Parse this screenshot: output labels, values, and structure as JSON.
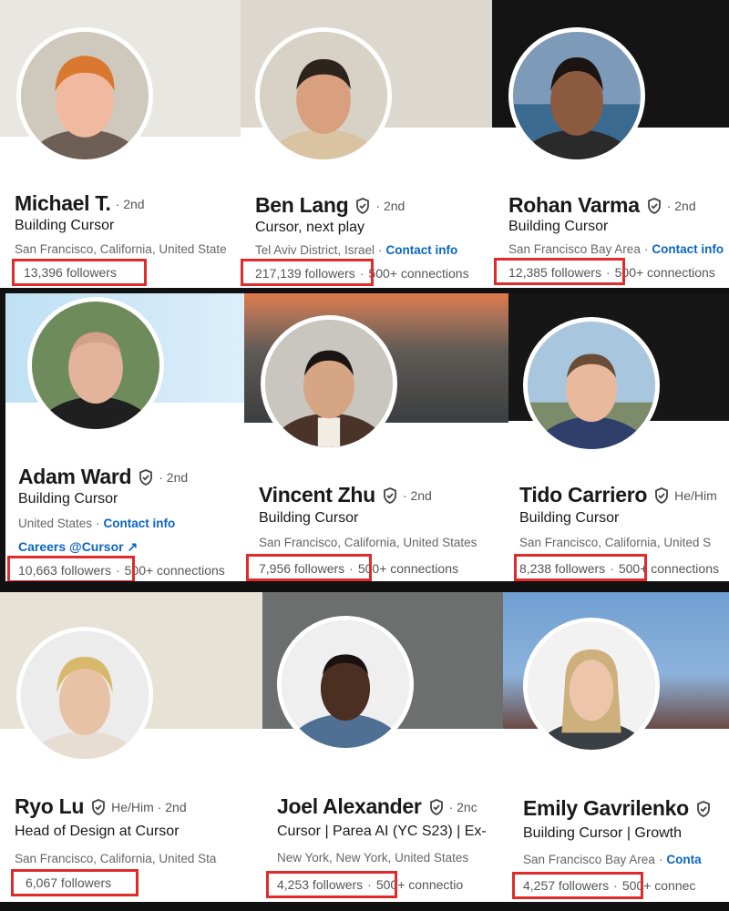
{
  "profiles": [
    {
      "name": "Michael T.",
      "extra": "· 2nd",
      "verified": false,
      "headline": "Building Cursor",
      "location": "San Francisco, California, United State",
      "contact": "",
      "careers": "",
      "followers": "13,396 followers",
      "connections": ""
    },
    {
      "name": "Ben Lang",
      "extra": "· 2nd",
      "verified": true,
      "headline": "Cursor, next play",
      "location": "Tel Aviv District, Israel",
      "contact": "Contact info",
      "careers": "",
      "followers": "217,139 followers",
      "connections": "500+ connections"
    },
    {
      "name": "Rohan Varma",
      "extra": "· 2nd",
      "verified": true,
      "headline": "Building Cursor",
      "location": "San Francisco Bay Area",
      "contact": "Contact info",
      "careers": "",
      "followers": "12,385 followers",
      "connections": "500+ connections"
    },
    {
      "name": "Adam Ward",
      "extra": "· 2nd",
      "verified": true,
      "headline": "Building Cursor",
      "location": "United States",
      "contact": "Contact info",
      "careers": "Careers @Cursor",
      "followers": "10,663 followers",
      "connections": "500+ connections"
    },
    {
      "name": "Vincent Zhu",
      "extra": "· 2nd",
      "verified": true,
      "headline": "Building Cursor",
      "location": "San Francisco, California, United States",
      "contact": "",
      "careers": "",
      "followers": "7,956 followers",
      "connections": "500+ connections"
    },
    {
      "name": "Tido Carriero",
      "extra": "He/Him",
      "verified": true,
      "headline": "Building Cursor",
      "location": "San Francisco, California, United S",
      "contact": "",
      "careers": "",
      "followers": "8,238 followers",
      "connections": "500+ connections"
    },
    {
      "name": "Ryo Lu",
      "extra": "He/Him · 2nd",
      "verified": true,
      "headline": "Head of Design at Cursor",
      "location": "San Francisco, California, United Sta",
      "contact": "",
      "careers": "",
      "followers": "6,067 followers",
      "connections": ""
    },
    {
      "name": "Joel Alexander",
      "extra": "· 2nc",
      "verified": true,
      "headline": "Cursor | Parea AI (YC S23) | Ex-",
      "location": "New York, New York, United States",
      "contact": "",
      "careers": "",
      "followers": "4,253 followers",
      "connections": "500+ connectio"
    },
    {
      "name": "Emily Gavrilenko",
      "extra": "",
      "verified": true,
      "headline": "Building Cursor | Growth",
      "location": "San Francisco Bay Area",
      "contact": "Conta",
      "careers": "",
      "followers": "4,257 followers",
      "connections": "500+ connec"
    }
  ],
  "colors": {
    "link": "#0a66c2",
    "highlight": "#e02b2b"
  }
}
